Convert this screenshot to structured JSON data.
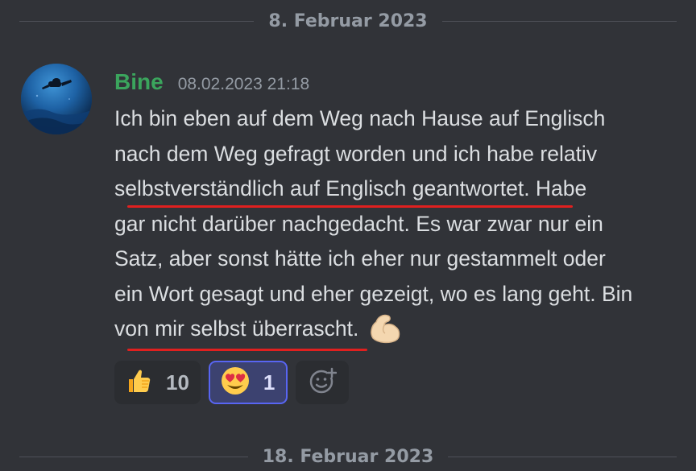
{
  "dividers": {
    "top_date": "8. Februar 2023",
    "bottom_date": "18. Februar 2023"
  },
  "message": {
    "author": "Bine",
    "author_color": "#3ba55d",
    "timestamp": "08.02.2023 21:18",
    "lines": [
      "Ich bin eben auf dem Weg nach Hause auf Englisch",
      "nach dem Weg gefragt worden und ich habe relativ",
      "selbstverständlich auf Englisch geantwortet. Habe",
      "gar nicht darüber nachgedacht. Es war zwar nur ein",
      "Satz, aber sonst hätte ich eher nur gestammelt oder",
      "ein Wort gesagt und eher gezeigt, wo es lang geht. Bin",
      "von mir selbst überrascht."
    ],
    "trailing_emoji": "flexed-biceps-icon",
    "underline_color": "#e0201f"
  },
  "reactions": [
    {
      "emoji": "thumbs-up-icon",
      "count": "10",
      "active": false
    },
    {
      "emoji": "heart-eyes-icon",
      "count": "1",
      "active": true
    }
  ],
  "add_reaction": {
    "icon": "add-reaction-icon"
  }
}
